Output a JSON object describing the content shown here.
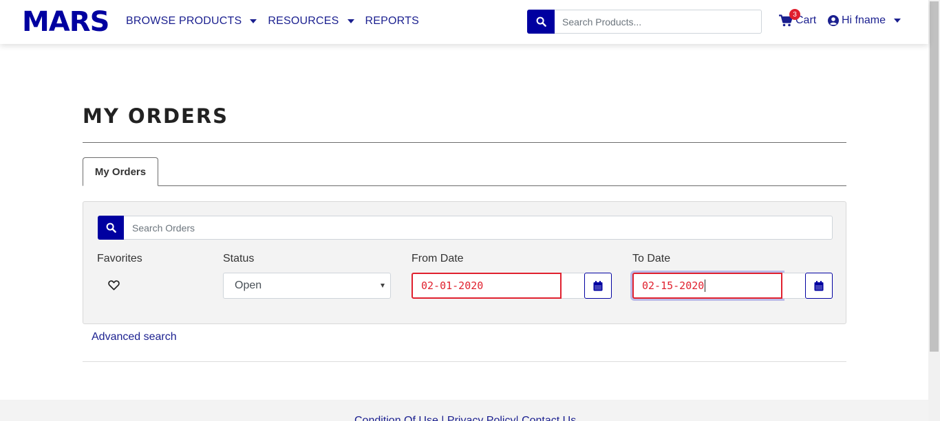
{
  "brand": {
    "logo_text": "MARS",
    "accent_color": "#0000a0",
    "error_color": "#e0202e"
  },
  "nav": [
    {
      "label": "BROWSE PRODUCTS",
      "has_dropdown": true
    },
    {
      "label": "RESOURCES",
      "has_dropdown": true
    },
    {
      "label": "REPORTS",
      "has_dropdown": false
    }
  ],
  "header_search": {
    "placeholder": "Search Products...",
    "icon": "search-icon"
  },
  "cart": {
    "label": "Cart",
    "count": "3",
    "icon": "shopping-cart-icon"
  },
  "user": {
    "greeting": "Hi fname",
    "icon": "user-circle-icon"
  },
  "page": {
    "title": "MY ORDERS"
  },
  "tabs": [
    {
      "label": "My Orders",
      "active": true
    }
  ],
  "filters": {
    "search_placeholder": "Search Orders",
    "favorites_label": "Favorites",
    "status_label": "Status",
    "status_value": "Open",
    "from_date_label": "From Date",
    "from_date_value": "02-01-2020",
    "to_date_label": "To Date",
    "to_date_value": "02-15-2020"
  },
  "advanced_search_label": "Advanced search",
  "footer": {
    "links": [
      "Condition Of Use",
      "Privacy Policy",
      "Contact Us"
    ],
    "separators": [
      " | ",
      "| "
    ]
  }
}
